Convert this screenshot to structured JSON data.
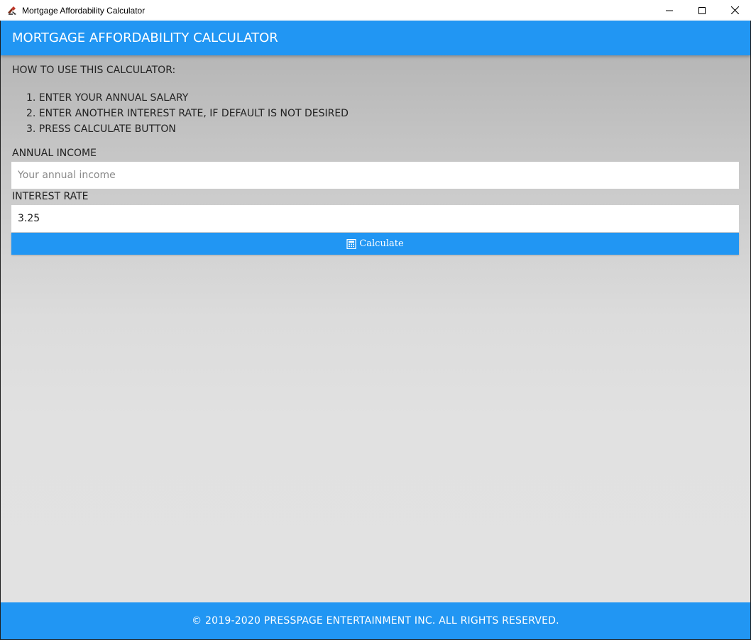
{
  "window": {
    "title": "Mortgage Affordability Calculator",
    "icons": {
      "app": "app-icon",
      "minimize": "minimize-icon",
      "maximize": "maximize-icon",
      "close": "close-icon"
    }
  },
  "header": {
    "title": "MORTGAGE AFFORDABILITY CALCULATOR"
  },
  "instructions": {
    "title": "HOW TO USE THIS CALCULATOR:",
    "steps": [
      "1. ENTER YOUR ANNUAL SALARY",
      "2. ENTER ANOTHER INTEREST RATE, IF DEFAULT IS NOT DESIRED",
      "3. PRESS CALCULATE BUTTON"
    ]
  },
  "form": {
    "income_label": "ANNUAL INCOME",
    "income_placeholder": "Your annual income",
    "income_value": "",
    "rate_label": "INTEREST RATE",
    "rate_value": "3.25",
    "calculate_label": "Calculate",
    "calculate_icon": "calculator-icon"
  },
  "footer": {
    "text": "© 2019-2020 PRESSPAGE ENTERTAINMENT INC. ALL RIGHTS RESERVED."
  },
  "colors": {
    "accent": "#2196f3",
    "titlebar": "#ffffff"
  }
}
